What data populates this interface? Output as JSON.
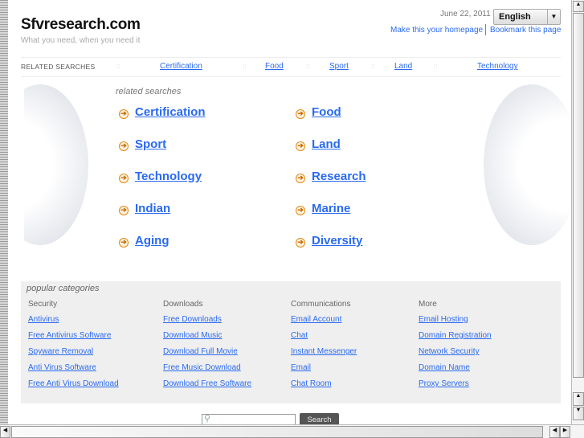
{
  "header": {
    "title": "Sfvresearch.com",
    "tagline": "What you need, when you need it",
    "date": "June 22, 2011",
    "language": "English",
    "homepage_link": "Make this your homepage",
    "bookmark_link": "Bookmark this page"
  },
  "top_bar": {
    "label": "RELATED SEARCHES",
    "separator": "::",
    "links": [
      "Certification",
      "Food",
      "Sport",
      "Land",
      "Technology"
    ]
  },
  "related": {
    "title": "related searches",
    "col1": [
      "Certification",
      "Sport",
      "Technology",
      "Indian",
      "Aging"
    ],
    "col2": [
      "Food",
      "Land",
      "Research",
      "Marine",
      "Diversity"
    ]
  },
  "popular": {
    "title": "popular categories",
    "columns": [
      {
        "heading": "Security",
        "links": [
          "Antivirus",
          "Free Antivirus Software",
          "Spyware Removal",
          "Anti Virus Software",
          "Free Anti Virus Download"
        ]
      },
      {
        "heading": "Downloads",
        "links": [
          "Free Downloads",
          "Download Music",
          "Download Full Movie",
          "Free Music Download",
          "Download Free Software"
        ]
      },
      {
        "heading": "Communications",
        "links": [
          "Email Account",
          "Chat",
          "Instant Messenger",
          "Email",
          "Chat Room"
        ]
      },
      {
        "heading": "More",
        "links": [
          "Email Hosting",
          "Domain Registration",
          "Network Security",
          "Domain Name",
          "Proxy Servers"
        ]
      }
    ]
  },
  "search": {
    "button": "Search",
    "value": ""
  },
  "colors": {
    "link": "#2a6af0",
    "accent": "#e08a10"
  }
}
